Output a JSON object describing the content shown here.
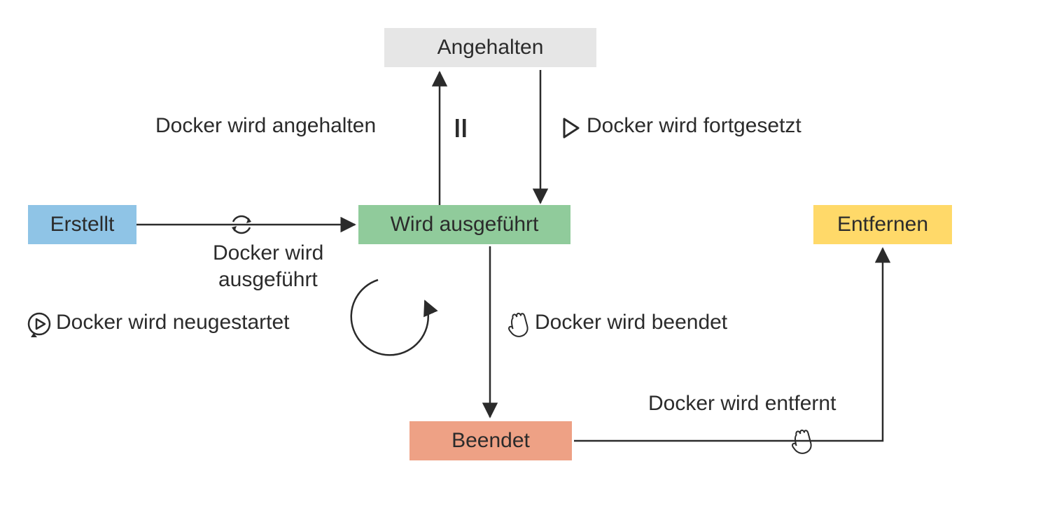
{
  "states": {
    "created": "Erstellt",
    "paused": "Angehalten",
    "running": "Wird ausgeführt",
    "stopped": "Beendet",
    "remove": "Entfernen"
  },
  "transitions": {
    "pause": "Docker wird angehalten",
    "unpause": "Docker wird fortgesetzt",
    "run1": "Docker wird",
    "run2": "ausgeführt",
    "restart": "Docker wird neugestartet",
    "stop": "Docker wird beendet",
    "rm": "Docker wird entfernt"
  },
  "colors": {
    "created": "#8fc4e6",
    "paused": "#e6e6e6",
    "running": "#90cb9b",
    "stopped": "#eea185",
    "remove": "#ffd969",
    "arrow": "#2b2b2b"
  }
}
